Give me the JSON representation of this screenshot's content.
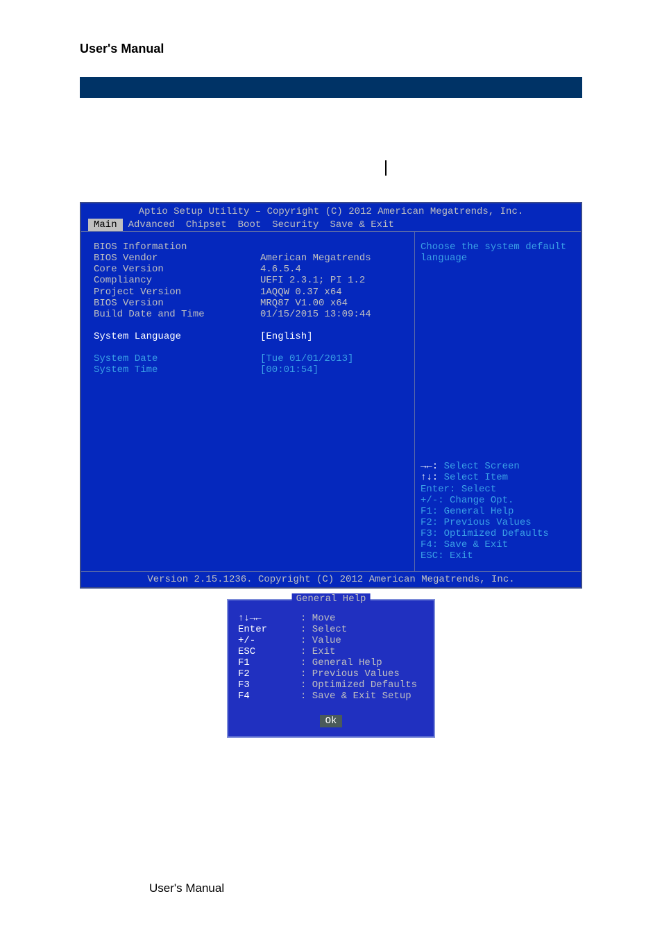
{
  "doc_title": "User's Manual",
  "page_footer": "User's Manual",
  "bios": {
    "header_title": "Aptio Setup Utility – Copyright (C) 2012 American Megatrends, Inc.",
    "tabs": [
      "Main",
      "Advanced",
      "Chipset",
      "Boot",
      "Security",
      "Save & Exit"
    ],
    "active_tab": 0,
    "section_title": "BIOS Information",
    "rows": [
      {
        "label": "BIOS Vendor",
        "value": "American Megatrends"
      },
      {
        "label": "Core Version",
        "value": "4.6.5.4"
      },
      {
        "label": "Compliancy",
        "value": "UEFI 2.3.1; PI 1.2"
      },
      {
        "label": "Project Version",
        "value": "1AQQW 0.37 x64"
      },
      {
        "label": "BIOS Version",
        "value": "MRQ87 V1.00 x64"
      },
      {
        "label": "Build Date and Time",
        "value": "01/15/2015 13:09:44"
      }
    ],
    "system_language": {
      "label": "System Language",
      "value": "[English]"
    },
    "system_date": {
      "label": "System Date",
      "value": "[Tue 01/01/2013]"
    },
    "system_time": {
      "label": "System Time",
      "value": "[00:01:54]"
    },
    "help_text": "Choose the system default language",
    "help_keys": [
      {
        "key": "→←",
        "desc": "Select Screen",
        "white": true
      },
      {
        "key": "↑↓",
        "desc": "Select Item",
        "white": true
      },
      {
        "key": "Enter",
        "desc": "Select",
        "white": false
      },
      {
        "key": "+/-",
        "desc": "Change Opt.",
        "white": false
      },
      {
        "key": "F1",
        "desc": "General Help",
        "white": false
      },
      {
        "key": "F2",
        "desc": "Previous Values",
        "white": false
      },
      {
        "key": "F3",
        "desc": "Optimized Defaults",
        "white": false
      },
      {
        "key": "F4",
        "desc": "Save & Exit",
        "white": false
      },
      {
        "key": "ESC",
        "desc": "Exit",
        "white": false
      }
    ],
    "footer": "Version 2.15.1236. Copyright (C) 2012 American Megatrends, Inc."
  },
  "general_help": {
    "title": "General Help",
    "rows": [
      {
        "key": "↑↓→←",
        "desc": ": Move"
      },
      {
        "key": "Enter",
        "desc": ": Select"
      },
      {
        "key": "+/-",
        "desc": ": Value"
      },
      {
        "key": "ESC",
        "desc": ": Exit"
      },
      {
        "key": "F1",
        "desc": ": General Help"
      },
      {
        "key": "F2",
        "desc": ": Previous Values"
      },
      {
        "key": "F3",
        "desc": ": Optimized Defaults"
      },
      {
        "key": "F4",
        "desc": ": Save & Exit Setup"
      }
    ],
    "ok": "Ok"
  }
}
